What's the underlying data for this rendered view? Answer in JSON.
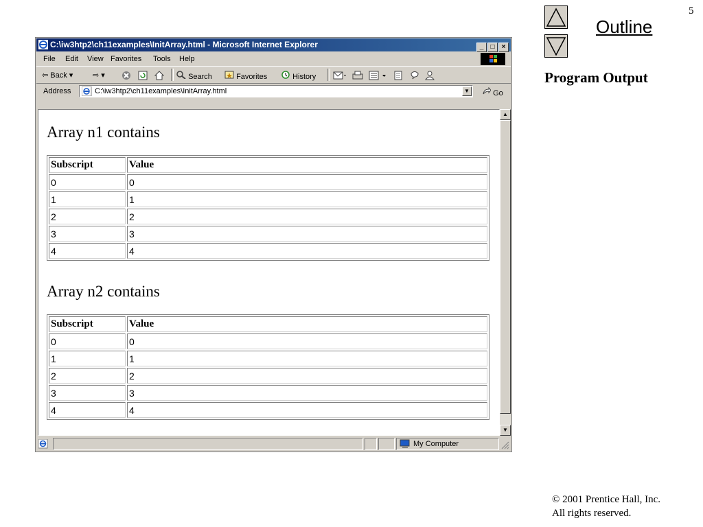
{
  "slide": {
    "number": "5",
    "outline_label": "Outline",
    "heading": "Program Output",
    "copyright_line1": "© 2001 Prentice Hall, Inc.",
    "copyright_line2": "All rights reserved."
  },
  "window": {
    "title": "C:\\iw3htp2\\ch11examples\\InitArray.html - Microsoft Internet Explorer",
    "minimize": "_",
    "maximize": "□",
    "close": "×"
  },
  "menu": [
    "File",
    "Edit",
    "View",
    "Favorites",
    "Tools",
    "Help"
  ],
  "toolbar": {
    "back": "⇦ Back ▾",
    "forward": "⇨ ▾",
    "search": "Search",
    "favorites": "Favorites",
    "history": "History"
  },
  "address": {
    "label": "Address",
    "value": "C:\\iw3htp2\\ch11examples\\InitArray.html",
    "go": "Go"
  },
  "page": {
    "arrays": [
      {
        "heading": "Array n1 contains",
        "headers": [
          "Subscript",
          "Value"
        ],
        "rows": [
          [
            "0",
            "0"
          ],
          [
            "1",
            "1"
          ],
          [
            "2",
            "2"
          ],
          [
            "3",
            "3"
          ],
          [
            "4",
            "4"
          ]
        ]
      },
      {
        "heading": "Array n2 contains",
        "headers": [
          "Subscript",
          "Value"
        ],
        "rows": [
          [
            "0",
            "0"
          ],
          [
            "1",
            "1"
          ],
          [
            "2",
            "2"
          ],
          [
            "3",
            "3"
          ],
          [
            "4",
            "4"
          ]
        ]
      }
    ]
  },
  "status": {
    "zone": "My Computer"
  }
}
